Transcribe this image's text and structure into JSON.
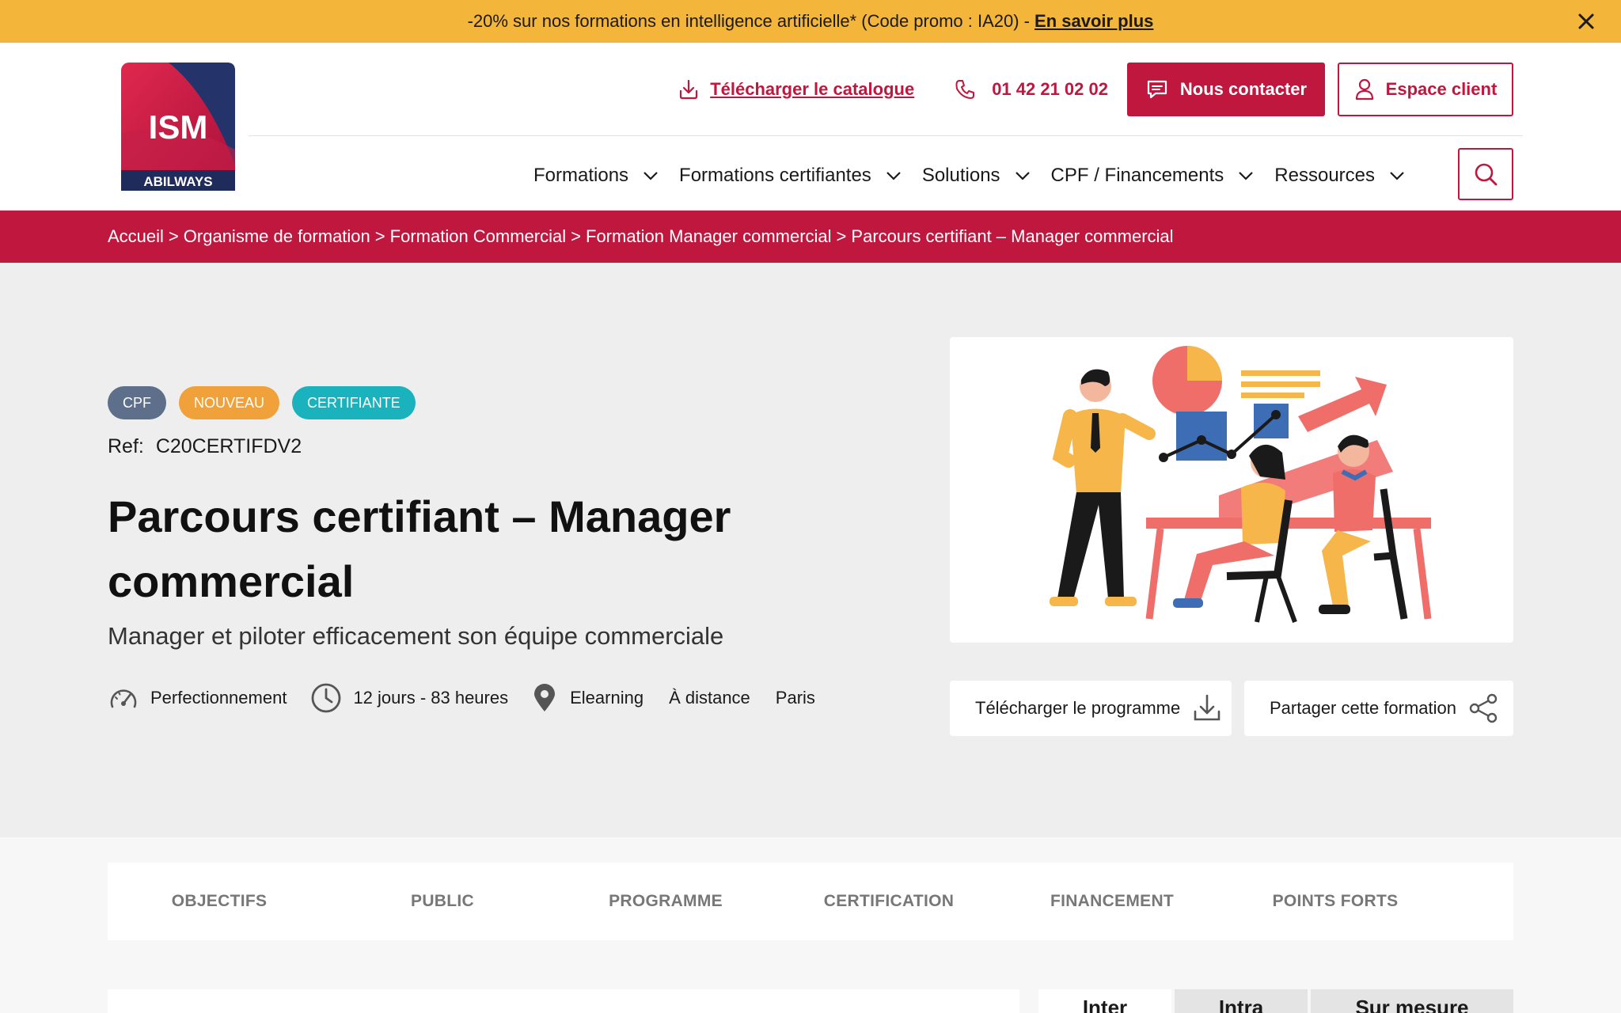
{
  "promo": {
    "text": "-20% sur nos formations en intelligence artificielle* (Code promo : IA20) -",
    "link": "En savoir plus"
  },
  "logo": {
    "brand": "ISM",
    "sub": "ABILWAYS"
  },
  "header": {
    "download_catalog": "Télécharger le catalogue",
    "phone": "01 42 21 02 02",
    "contact": "Nous contacter",
    "client": "Espace client"
  },
  "nav": {
    "items": [
      {
        "label": "Formations"
      },
      {
        "label": "Formations certifiantes"
      },
      {
        "label": "Solutions"
      },
      {
        "label": "CPF / Financements"
      },
      {
        "label": "Ressources"
      }
    ]
  },
  "breadcrumb": [
    "Accueil",
    "Organisme de formation",
    "Formation Commercial",
    "Formation Manager commercial",
    "Parcours certifiant – Manager commercial"
  ],
  "breadcrumb_sep": ">",
  "course": {
    "badges": [
      {
        "label": "CPF",
        "color": "#5d6f8a"
      },
      {
        "label": "NOUVEAU",
        "color": "#f0a13a"
      },
      {
        "label": "CERTIFIANTE",
        "color": "#19b2bd"
      }
    ],
    "ref_label": "Ref:",
    "ref": "C20CERTIFDV2",
    "title": "Parcours certifiant – Manager commercial",
    "subtitle": "Manager et piloter efficacement son équipe commerciale",
    "level": "Perfectionnement",
    "duration": "12 jours - 83 heures",
    "locations": [
      "Elearning",
      "À distance",
      "Paris"
    ]
  },
  "actions": {
    "download_program": "Télécharger le programme",
    "share": "Partager cette formation"
  },
  "tabs": [
    "OBJECTIFS",
    "PUBLIC",
    "PROGRAMME",
    "CERTIFICATION",
    "FINANCEMENT",
    "POINTS FORTS"
  ],
  "modes": [
    "Inter",
    "Intra",
    "Sur mesure"
  ],
  "colors": {
    "brand": "#c0173f",
    "promo_bg": "#f4b53b",
    "hero_bg": "#eeeeee"
  }
}
